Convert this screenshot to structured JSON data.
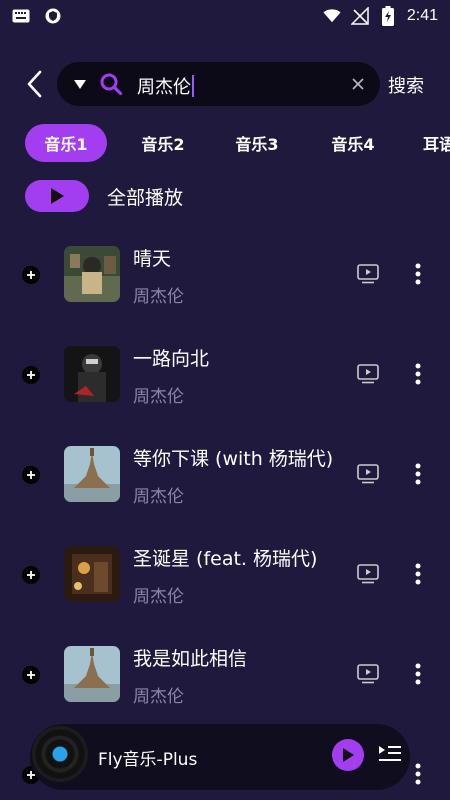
{
  "status_bar": {
    "time": "2:41",
    "icons": [
      "keyboard-icon",
      "shield-icon",
      "wifi-icon",
      "no-signal-icon",
      "battery-charging-icon"
    ]
  },
  "header": {
    "search_value": "周杰伦",
    "search_button": "搜索",
    "icons": [
      "back-icon",
      "dropdown-icon",
      "search-icon",
      "clear-icon"
    ]
  },
  "tabs": [
    {
      "label": "音乐1",
      "active": true
    },
    {
      "label": "音乐2",
      "active": false
    },
    {
      "label": "音乐3",
      "active": false
    },
    {
      "label": "音乐4",
      "active": false
    },
    {
      "label": "耳语",
      "active": false
    }
  ],
  "play_all": {
    "label": "全部播放"
  },
  "songs": [
    {
      "title": "晴天",
      "artist": "周杰伦"
    },
    {
      "title": "一路向北",
      "artist": "周杰伦"
    },
    {
      "title": "等你下课 (with 杨瑞代)",
      "artist": "周杰伦"
    },
    {
      "title": "圣诞星 (feat. 杨瑞代)",
      "artist": "周杰伦"
    },
    {
      "title": "我是如此相信",
      "artist": "周杰伦"
    }
  ],
  "mini_player": {
    "title": "Fly音乐-Plus"
  },
  "colors": {
    "background": "#1f1a3d",
    "accent": "#a33ef0",
    "artist_text": "#8a86a6",
    "search_bg": "#0b0a16"
  }
}
